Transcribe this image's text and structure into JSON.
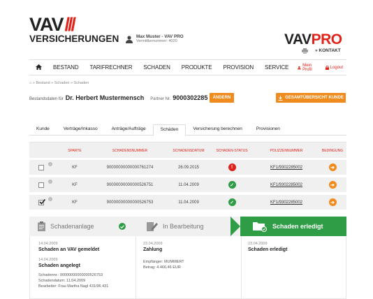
{
  "brand": {
    "vav": "VAV",
    "vav_slashes": "///",
    "vers": "VERSICHERUNGEN",
    "pro_left": "VAV",
    "pro_right": "PRO",
    "contact": "» KONTAKT"
  },
  "user": {
    "name": "Max Muster - VAV PRO",
    "number": "Vermittlernummer: 4020"
  },
  "nav": {
    "items": [
      "BESTAND",
      "TARIFRECHNER",
      "SCHADEN",
      "PRODUKTE",
      "PROVISION",
      "SERVICE"
    ],
    "profile": "Mein Profil",
    "logout": "Logout"
  },
  "breadcrumb": "» Bestand » Schaden » Schaden",
  "customer": {
    "label": "Bestandsdaten für",
    "name": "Dr. Herbert Mustermensch",
    "partner_label": "Partner Nr.",
    "partner_no": "9000302285",
    "edit": "ÄNDERN",
    "overview": "GESAMTÜBERSICHT KUNDE"
  },
  "tabs": [
    "Kunde",
    "Verträge/Inkasso",
    "Anträge/Aufträge",
    "Schäden",
    "Versicherung berechnen",
    "Provisionen"
  ],
  "active_tab": "Schäden",
  "table": {
    "headers": [
      "SPARTE",
      "SCHADENSNUMMER",
      "SCHADENSDATUM",
      "SCHADEN-STATUS",
      "POLIZZENNUMMER",
      "BEDINGUNG"
    ],
    "rows": [
      {
        "sparte": "KF",
        "nr": "90000000000000761274",
        "datum": "26.09.2015",
        "status": "error",
        "polizze": "KF1/9302285002",
        "checked": false
      },
      {
        "sparte": "KF",
        "nr": "90000000000000526751",
        "datum": "11.04.2009",
        "status": "ok",
        "polizze": "KF1/9302285002",
        "checked": false
      },
      {
        "sparte": "KF",
        "nr": "90000000000000526753",
        "datum": "11.04.2009",
        "status": "ok",
        "polizze": "KF1/9302285002",
        "checked": true
      }
    ]
  },
  "steps": [
    "Schadenanlage",
    "In Bearbeitung",
    "Schaden erledigt"
  ],
  "details": {
    "c1": {
      "d1": "14.04.2009",
      "e1": "Schaden an VAV gemeldet",
      "d2": "14.04.2009",
      "e2": "Schaden angelegt",
      "l1": "Schadennr.: 90000000000000526753",
      "l2": "Schadendatum: 11.04.2009",
      "l3": "Bearbeiter: Frau Martha Nagl 431/96 431"
    },
    "c2": {
      "d1": "23.04.2009",
      "e1": "Zahlung",
      "l1": "Empfänger: MUMMERT",
      "l2": "Betrag: 4.466,46 EUR"
    },
    "c3": {
      "d1": "23.04.2009",
      "e1": "Schaden erledigt"
    }
  },
  "colors": {
    "accent": "#e2231a",
    "orange": "#f08b1d",
    "green": "#2e9d46"
  }
}
